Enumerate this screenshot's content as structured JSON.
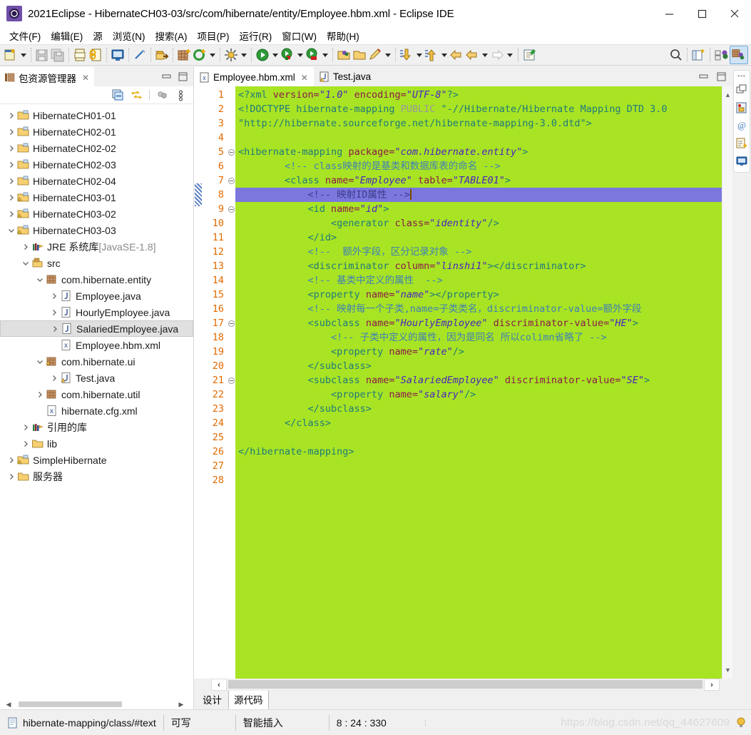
{
  "window": {
    "title": "2021Eclipse - HibernateCH03-03/src/com/hibernate/entity/Employee.hbm.xml - Eclipse IDE",
    "app_icon": "eclipse-icon",
    "minimize_label": "–",
    "maximize_label": "□",
    "close_label": "✕"
  },
  "menubar": {
    "items": [
      {
        "label": "文件(F)"
      },
      {
        "label": "编辑(E)"
      },
      {
        "label": "源"
      },
      {
        "label": "浏览(N)"
      },
      {
        "label": "搜索(A)"
      },
      {
        "label": "项目(P)"
      },
      {
        "label": "运行(R)"
      },
      {
        "label": "窗口(W)"
      },
      {
        "label": "帮助(H)"
      }
    ]
  },
  "toolbar": {
    "groups": [
      {
        "items": [
          {
            "icon": "new-wizard-icon",
            "dropdown": true
          }
        ]
      },
      {
        "items": [
          {
            "icon": "save-icon",
            "dropdown": false
          },
          {
            "icon": "save-all-icon",
            "dropdown": false
          }
        ]
      },
      {
        "items": [
          {
            "icon": "print-icon",
            "dropdown": false
          },
          {
            "icon": "export-icon",
            "dropdown": false
          }
        ]
      },
      {
        "items": [
          {
            "icon": "console-icon",
            "dropdown": false
          }
        ]
      },
      {
        "items": [
          {
            "icon": "annotation-icon",
            "dropdown": false
          }
        ]
      },
      {
        "items": [
          {
            "icon": "open-type-icon",
            "dropdown": false
          }
        ]
      },
      {
        "items": [
          {
            "icon": "new-package-icon",
            "dropdown": false
          },
          {
            "icon": "refresh-icon",
            "dropdown": true
          }
        ]
      },
      {
        "items": [
          {
            "icon": "external-tools-icon",
            "dropdown": true
          }
        ]
      },
      {
        "items": [
          {
            "icon": "run-icon",
            "dropdown": true
          },
          {
            "icon": "debug-icon",
            "dropdown": true
          },
          {
            "icon": "coverage-icon",
            "dropdown": true
          }
        ]
      },
      {
        "items": [
          {
            "icon": "open-folder-icon",
            "dropdown": false
          },
          {
            "icon": "open-resource-icon",
            "dropdown": false
          },
          {
            "icon": "pencil-icon",
            "dropdown": true
          }
        ]
      },
      {
        "items": [
          {
            "icon": "next-annotation-icon",
            "dropdown": true
          },
          {
            "icon": "prev-annotation-icon",
            "dropdown": true
          },
          {
            "icon": "back-icon",
            "dropdown": false
          },
          {
            "icon": "back-history-icon",
            "dropdown": true
          },
          {
            "icon": "forward-icon",
            "dropdown": true
          }
        ]
      },
      {
        "items": [
          {
            "icon": "new-editor-icon",
            "dropdown": false
          }
        ]
      }
    ],
    "right_items": [
      {
        "icon": "search-icon"
      },
      {
        "icon": "new-perspective-icon"
      },
      {
        "icon": "java-perspective-icon"
      },
      {
        "icon": "java-ee-perspective-icon",
        "active": true
      }
    ]
  },
  "explorer": {
    "tab": {
      "label": "包资源管理器",
      "icon": "package-explorer-icon",
      "close": "✕"
    },
    "view_buttons": [
      {
        "icon": "minimize-view-icon"
      },
      {
        "icon": "maximize-view-icon"
      }
    ],
    "toolbar_buttons": [
      {
        "icon": "collapse-all-icon"
      },
      {
        "icon": "link-with-editor-icon"
      },
      {
        "icon": "view-menu-filter-icon"
      },
      {
        "icon": "view-menu-icon"
      }
    ],
    "tree": [
      {
        "label": "HibernateCH01-01",
        "icon": "project-icon",
        "twisty": "collapsed",
        "indent": 0
      },
      {
        "label": "HibernateCH02-01",
        "icon": "project-icon",
        "twisty": "collapsed",
        "indent": 0
      },
      {
        "label": "HibernateCH02-02",
        "icon": "project-icon",
        "twisty": "collapsed",
        "indent": 0
      },
      {
        "label": "HibernateCH02-03",
        "icon": "project-icon",
        "twisty": "collapsed",
        "indent": 0
      },
      {
        "label": "HibernateCH02-04",
        "icon": "project-icon",
        "twisty": "collapsed",
        "indent": 0
      },
      {
        "label": "HibernateCH03-01",
        "icon": "project-warn-icon",
        "twisty": "collapsed",
        "indent": 0
      },
      {
        "label": "HibernateCH03-02",
        "icon": "project-warn-icon",
        "twisty": "collapsed",
        "indent": 0
      },
      {
        "label": "HibernateCH03-03",
        "icon": "project-warn-icon",
        "twisty": "expanded",
        "indent": 0
      },
      {
        "label": "JRE 系统库",
        "suffix": " [JavaSE-1.8]",
        "icon": "library-icon",
        "twisty": "collapsed",
        "indent": 1
      },
      {
        "label": "src",
        "icon": "source-folder-icon",
        "twisty": "expanded",
        "indent": 1
      },
      {
        "label": "com.hibernate.entity",
        "icon": "package-icon",
        "twisty": "expanded",
        "indent": 2
      },
      {
        "label": "Employee.java",
        "icon": "java-file-icon",
        "twisty": "collapsed",
        "indent": 3
      },
      {
        "label": "HourlyEmployee.java",
        "icon": "java-file-icon",
        "twisty": "collapsed",
        "indent": 3
      },
      {
        "label": "SalariedEmployee.java",
        "icon": "java-file-icon",
        "twisty": "collapsed",
        "indent": 3,
        "selected": true
      },
      {
        "label": "Employee.hbm.xml",
        "icon": "xml-file-icon",
        "twisty": "none",
        "indent": 3
      },
      {
        "label": "com.hibernate.ui",
        "icon": "package-warn-icon",
        "twisty": "expanded",
        "indent": 2
      },
      {
        "label": "Test.java",
        "icon": "java-file-warn-icon",
        "twisty": "collapsed",
        "indent": 3
      },
      {
        "label": "com.hibernate.util",
        "icon": "package-icon",
        "twisty": "collapsed",
        "indent": 2
      },
      {
        "label": "hibernate.cfg.xml",
        "icon": "xml-file-icon",
        "twisty": "none",
        "indent": 2
      },
      {
        "label": "引用的库",
        "icon": "library-icon",
        "twisty": "collapsed",
        "indent": 1
      },
      {
        "label": "lib",
        "icon": "folder-icon",
        "twisty": "collapsed",
        "indent": 1
      },
      {
        "label": "SimpleHibernate",
        "icon": "project-warn-icon",
        "twisty": "collapsed",
        "indent": 0
      },
      {
        "label": "服务器",
        "icon": "folder-icon",
        "twisty": "collapsed",
        "indent": 0
      }
    ]
  },
  "editor": {
    "tabs": [
      {
        "label": "Employee.hbm.xml",
        "icon": "xml-file-icon",
        "active": true,
        "close": "✕"
      },
      {
        "label": "Test.java",
        "icon": "java-file-warn-icon",
        "active": false
      }
    ],
    "view_buttons": [
      {
        "icon": "minimize-view-icon"
      },
      {
        "icon": "maximize-view-icon"
      }
    ],
    "bottom_tabs": [
      {
        "label": "设计",
        "active": false
      },
      {
        "label": "源代码",
        "active": true
      }
    ],
    "background_color": "#a8e423",
    "highlight_color": "#7b77dd",
    "line_number_color": "#e36900",
    "total_lines": 28,
    "cursor_line": 8,
    "lines": [
      {
        "n": 1,
        "fold": false,
        "tokens": [
          {
            "t": "<?xml ",
            "c": "mk"
          },
          {
            "t": "version=",
            "c": "at"
          },
          {
            "t": "\"1.0\"",
            "c": "val"
          },
          {
            "t": " ",
            "c": "pl"
          },
          {
            "t": "encoding=",
            "c": "at"
          },
          {
            "t": "\"UTF-8\"",
            "c": "val"
          },
          {
            "t": "?>",
            "c": "mk"
          }
        ]
      },
      {
        "n": 2,
        "fold": false,
        "tokens": [
          {
            "t": "<!DOCTYPE ",
            "c": "mk"
          },
          {
            "t": "hibernate-mapping ",
            "c": "mk"
          },
          {
            "t": "PUBLIC ",
            "c": "kw"
          },
          {
            "t": "\"-//Hibernate/Hibernate Mapping DTD 3.0",
            "c": "mk"
          }
        ]
      },
      {
        "n": 3,
        "fold": false,
        "tokens": [
          {
            "t": "\"http://hibernate.sourceforge.net/hibernate-mapping-3.0.dtd\">",
            "c": "mk"
          }
        ]
      },
      {
        "n": 4,
        "fold": false,
        "tokens": []
      },
      {
        "n": 5,
        "fold": true,
        "tokens": [
          {
            "t": "<hibernate-mapping ",
            "c": "mk"
          },
          {
            "t": "package=",
            "c": "at"
          },
          {
            "t": "\"com.hibernate.entity\"",
            "c": "val"
          },
          {
            "t": ">",
            "c": "mk"
          }
        ]
      },
      {
        "n": 6,
        "fold": false,
        "tokens": [
          {
            "t": "        <!-- class映射的是基类和数据库表的命名 -->",
            "c": "cm"
          }
        ]
      },
      {
        "n": 7,
        "fold": true,
        "tokens": [
          {
            "t": "        <class ",
            "c": "mk"
          },
          {
            "t": "name=",
            "c": "at"
          },
          {
            "t": "\"Employee\"",
            "c": "val"
          },
          {
            "t": " ",
            "c": "pl"
          },
          {
            "t": "table=",
            "c": "at"
          },
          {
            "t": "\"TABLE01\"",
            "c": "val"
          },
          {
            "t": ">",
            "c": "mk"
          }
        ]
      },
      {
        "n": 8,
        "fold": false,
        "highlight": true,
        "caret": true,
        "tokens": [
          {
            "t": "            <!-- 映射ID属性 -->",
            "c": "cm"
          }
        ]
      },
      {
        "n": 9,
        "fold": true,
        "tokens": [
          {
            "t": "            <id ",
            "c": "mk"
          },
          {
            "t": "name=",
            "c": "at"
          },
          {
            "t": "\"id\"",
            "c": "val"
          },
          {
            "t": ">",
            "c": "mk"
          }
        ]
      },
      {
        "n": 10,
        "fold": false,
        "tokens": [
          {
            "t": "                <generator ",
            "c": "mk"
          },
          {
            "t": "class=",
            "c": "at"
          },
          {
            "t": "\"identity\"",
            "c": "val"
          },
          {
            "t": "/>",
            "c": "mk"
          }
        ]
      },
      {
        "n": 11,
        "fold": false,
        "tokens": [
          {
            "t": "            </id>",
            "c": "mk"
          }
        ]
      },
      {
        "n": 12,
        "fold": false,
        "tokens": [
          {
            "t": "            <!--  额外字段，区分记录对象 -->",
            "c": "cm"
          }
        ]
      },
      {
        "n": 13,
        "fold": false,
        "tokens": [
          {
            "t": "            <discriminator ",
            "c": "mk"
          },
          {
            "t": "column=",
            "c": "at"
          },
          {
            "t": "\"linshi1\"",
            "c": "val"
          },
          {
            "t": "></discriminator>",
            "c": "mk"
          }
        ]
      },
      {
        "n": 14,
        "fold": false,
        "tokens": [
          {
            "t": "            <!-- 基类中定义的属性  -->",
            "c": "cm"
          }
        ]
      },
      {
        "n": 15,
        "fold": false,
        "tokens": [
          {
            "t": "            <property ",
            "c": "mk"
          },
          {
            "t": "name=",
            "c": "at"
          },
          {
            "t": "\"name\"",
            "c": "val"
          },
          {
            "t": "></property>",
            "c": "mk"
          }
        ]
      },
      {
        "n": 16,
        "fold": false,
        "tokens": [
          {
            "t": "            <!-- 映射每一个子类,name=子类类名，discriminator-value=额外字段",
            "c": "cm"
          }
        ]
      },
      {
        "n": 17,
        "fold": true,
        "tokens": [
          {
            "t": "            <subclass ",
            "c": "mk"
          },
          {
            "t": "name=",
            "c": "at"
          },
          {
            "t": "\"HourlyEmployee\"",
            "c": "val"
          },
          {
            "t": " ",
            "c": "pl"
          },
          {
            "t": "discriminator-value=",
            "c": "at"
          },
          {
            "t": "\"HE\"",
            "c": "val"
          },
          {
            "t": ">",
            "c": "mk"
          }
        ]
      },
      {
        "n": 18,
        "fold": false,
        "tokens": [
          {
            "t": "                <!-- 子类中定义的属性，因为是同名 所以colimn省略了 -->",
            "c": "cm"
          }
        ]
      },
      {
        "n": 19,
        "fold": false,
        "tokens": [
          {
            "t": "                <property ",
            "c": "mk"
          },
          {
            "t": "name=",
            "c": "at"
          },
          {
            "t": "\"rate\"",
            "c": "val"
          },
          {
            "t": "/>",
            "c": "mk"
          }
        ]
      },
      {
        "n": 20,
        "fold": false,
        "tokens": [
          {
            "t": "            </subclass>",
            "c": "mk"
          }
        ]
      },
      {
        "n": 21,
        "fold": true,
        "tokens": [
          {
            "t": "            <subclass ",
            "c": "mk"
          },
          {
            "t": "name=",
            "c": "at"
          },
          {
            "t": "\"SalariedEmployee\"",
            "c": "val"
          },
          {
            "t": " ",
            "c": "pl"
          },
          {
            "t": "discriminator-value=",
            "c": "at"
          },
          {
            "t": "\"SE\"",
            "c": "val"
          },
          {
            "t": ">",
            "c": "mk"
          }
        ]
      },
      {
        "n": 22,
        "fold": false,
        "tokens": [
          {
            "t": "                <property ",
            "c": "mk"
          },
          {
            "t": "name=",
            "c": "at"
          },
          {
            "t": "\"salary\"",
            "c": "val"
          },
          {
            "t": "/>",
            "c": "mk"
          }
        ]
      },
      {
        "n": 23,
        "fold": false,
        "tokens": [
          {
            "t": "            </subclass>",
            "c": "mk"
          }
        ]
      },
      {
        "n": 24,
        "fold": false,
        "tokens": [
          {
            "t": "        </class>",
            "c": "mk"
          }
        ]
      },
      {
        "n": 25,
        "fold": false,
        "tokens": []
      },
      {
        "n": 26,
        "fold": false,
        "tokens": [
          {
            "t": "</hibernate-mapping>",
            "c": "mk"
          }
        ]
      },
      {
        "n": 27,
        "fold": false,
        "tokens": []
      },
      {
        "n": 28,
        "fold": false,
        "tokens": []
      }
    ]
  },
  "right_rail": {
    "items": [
      {
        "icon": "restore-view-icon"
      },
      {
        "icon": "outline-view-icon"
      },
      {
        "icon": "at-sign-icon"
      },
      {
        "icon": "properties-view-icon"
      },
      {
        "icon": "console-view-icon"
      }
    ]
  },
  "statusbar": {
    "selection_path": "hibernate-mapping/class/#text",
    "selection_icon": "document-icon",
    "writable": "可写",
    "insert_mode": "智能插入",
    "cursor_position": "8 : 24 : 330",
    "watermark": "https://blog.csdn.net/qq_44627609"
  }
}
